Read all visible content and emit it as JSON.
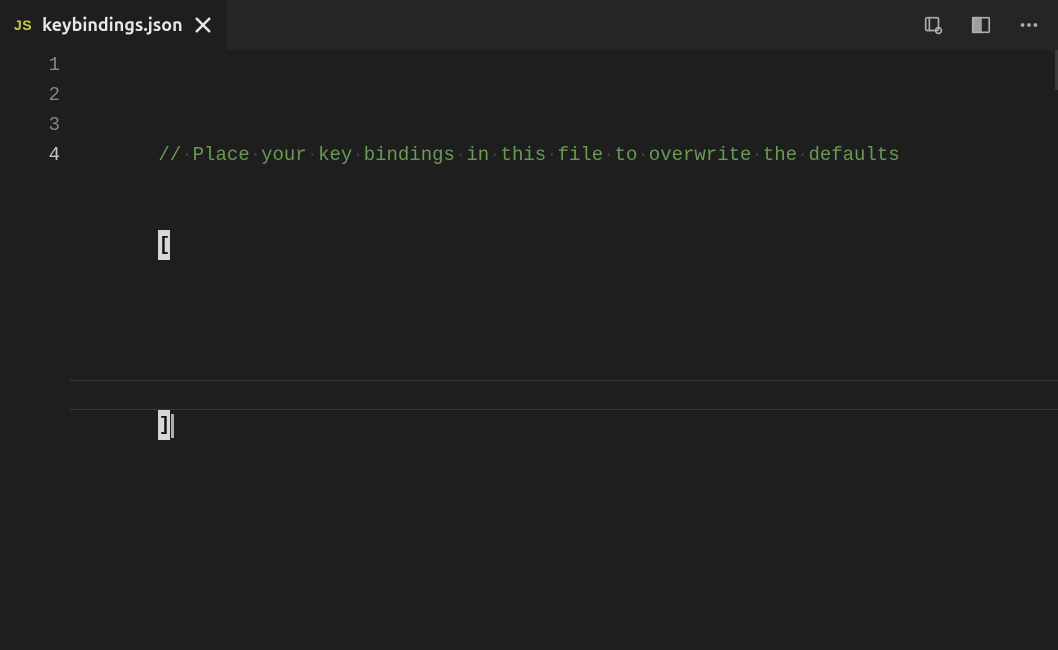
{
  "tab": {
    "icon_label": "JS",
    "filename": "keybindings.json"
  },
  "gutter": {
    "lines": [
      "1",
      "2",
      "3",
      "4"
    ],
    "active_index": 3
  },
  "code": {
    "comment_slashes": "//",
    "comment_words": [
      "Place",
      "your",
      "key",
      "bindings",
      "in",
      "this",
      "file",
      "to",
      "overwrite",
      "the",
      "defaults"
    ],
    "open_bracket": "[",
    "close_bracket": "]"
  }
}
